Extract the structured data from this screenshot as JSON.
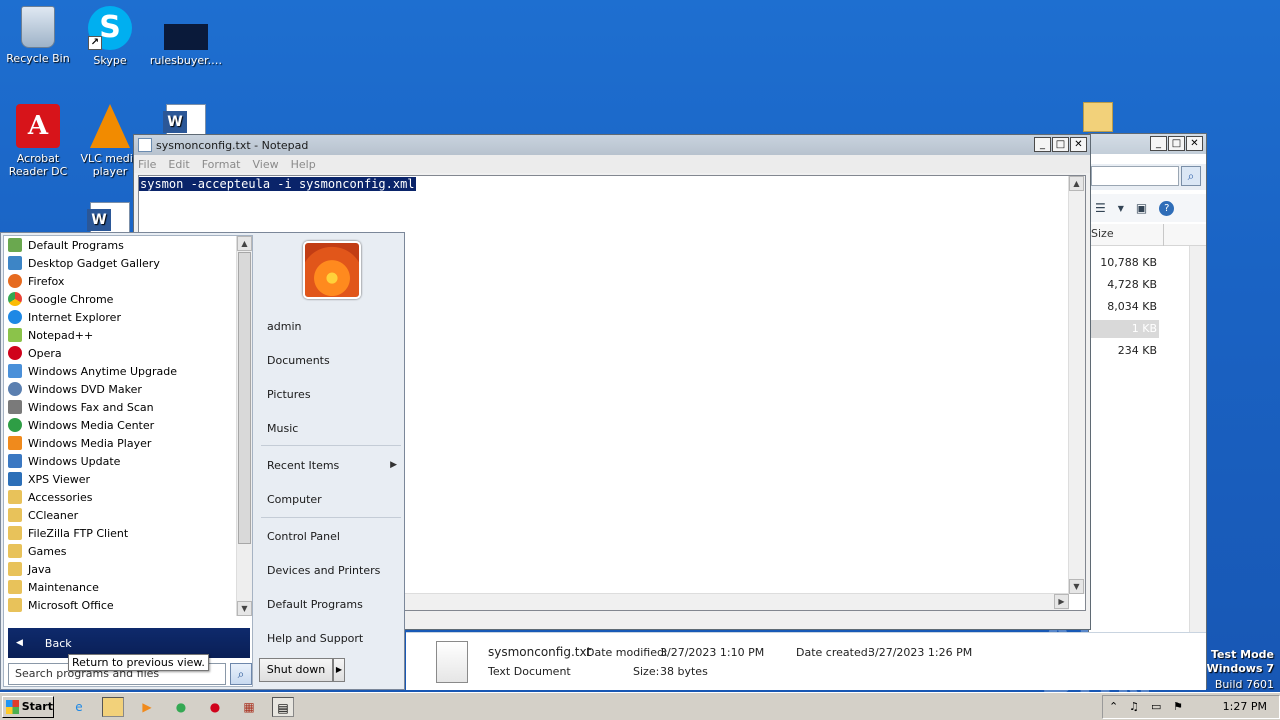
{
  "desktop_icons": [
    {
      "label": "Recycle Bin",
      "icon": "recycle-bin-icon"
    },
    {
      "label": "Skype",
      "icon": "skype-icon"
    },
    {
      "label": "rulesbuyer.…",
      "icon": "file-icon"
    },
    {
      "label": "Acrobat Reader DC",
      "line1": "Acrobat",
      "line2": "Reader DC",
      "icon": "acrobat-icon"
    },
    {
      "label": "VLC media player",
      "line1": "VLC media",
      "line2": "player",
      "icon": "vlc-icon"
    }
  ],
  "notepad": {
    "title": "sysmonconfig.txt - Notepad",
    "menu": [
      "File",
      "Edit",
      "Format",
      "View",
      "Help"
    ],
    "content": "sysmon -accepteula -i sysmonconfig.xml"
  },
  "explorer": {
    "column_header": "Size",
    "sizes": [
      "10,788 KB",
      "4,728 KB",
      "8,034 KB",
      "1 KB",
      "234 KB"
    ]
  },
  "details_pane": {
    "filename": "sysmonconfig.txt",
    "type": "Text Document",
    "modified_label": "Date modified:",
    "modified_value": "3/27/2023 1:10 PM",
    "size_label": "Size:",
    "size_value": "38 bytes",
    "created_label": "Date created:",
    "created_value": "3/27/2023 1:26 PM"
  },
  "start_menu": {
    "programs": [
      {
        "label": "Default Programs",
        "color": "#6aa84f"
      },
      {
        "label": "Desktop Gadget Gallery",
        "color": "#3d85c6"
      },
      {
        "label": "Firefox",
        "color": "#e66a1f"
      },
      {
        "label": "Google Chrome",
        "color": "#34a853"
      },
      {
        "label": "Internet Explorer",
        "color": "#1e88e5"
      },
      {
        "label": "Notepad++",
        "color": "#8bc34a"
      },
      {
        "label": "Opera",
        "color": "#d0021b"
      },
      {
        "label": "Windows Anytime Upgrade",
        "color": "#4a90d9"
      },
      {
        "label": "Windows DVD Maker",
        "color": "#5a7fb0"
      },
      {
        "label": "Windows Fax and Scan",
        "color": "#7a7a7a"
      },
      {
        "label": "Windows Media Center",
        "color": "#2e9e45"
      },
      {
        "label": "Windows Media Player",
        "color": "#f08a1c"
      },
      {
        "label": "Windows Update",
        "color": "#3b78c2"
      },
      {
        "label": "XPS Viewer",
        "color": "#2c6fb8"
      },
      {
        "label": "Accessories",
        "color": "#e8c25a"
      },
      {
        "label": "CCleaner",
        "color": "#e8c25a"
      },
      {
        "label": "FileZilla FTP Client",
        "color": "#e8c25a"
      },
      {
        "label": "Games",
        "color": "#e8c25a"
      },
      {
        "label": "Java",
        "color": "#e8c25a"
      },
      {
        "label": "Maintenance",
        "color": "#e8c25a"
      },
      {
        "label": "Microsoft Office",
        "color": "#e8c25a"
      }
    ],
    "back_label": "Back",
    "search_placeholder": "Search programs and files",
    "tooltip": "Return to previous view.",
    "user": "admin",
    "right_links": [
      "Documents",
      "Pictures",
      "Music",
      "Recent Items",
      "Computer",
      "Control Panel",
      "Devices and Printers",
      "Default Programs",
      "Help and Support"
    ],
    "shutdown_label": "Shut down"
  },
  "taskbar": {
    "start_label": "Start",
    "clock": "1:27 PM"
  },
  "watermark": {
    "line1": "Test Mode",
    "line2": "Windows 7",
    "line3": "Build 7601",
    "brand": "ANY RUN"
  }
}
